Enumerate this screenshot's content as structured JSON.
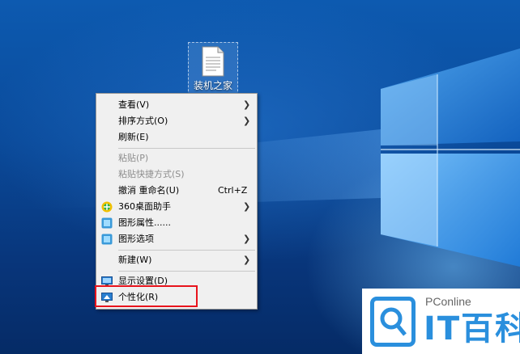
{
  "desktop": {
    "file_icon": {
      "label": "装机之家",
      "icon": "document-icon"
    }
  },
  "context_menu": {
    "items": [
      {
        "label": "查看(V)",
        "submenu": true,
        "enabled": true
      },
      {
        "label": "排序方式(O)",
        "submenu": true,
        "enabled": true
      },
      {
        "label": "刷新(E)",
        "enabled": true
      },
      {
        "label": "粘贴(P)",
        "enabled": false
      },
      {
        "label": "粘贴快捷方式(S)",
        "enabled": false
      },
      {
        "label": "撤消 重命名(U)",
        "shortcut": "Ctrl+Z",
        "enabled": true
      },
      {
        "label": "360桌面助手",
        "submenu": true,
        "enabled": true,
        "icon": "360-icon"
      },
      {
        "label": "图形属性......",
        "enabled": true,
        "icon": "graphics-properties-icon"
      },
      {
        "label": "图形选项",
        "submenu": true,
        "enabled": true,
        "icon": "graphics-options-icon"
      },
      {
        "label": "新建(W)",
        "submenu": true,
        "enabled": true
      },
      {
        "label": "显示设置(D)",
        "enabled": true,
        "icon": "display-settings-icon"
      },
      {
        "label": "个性化(R)",
        "enabled": true,
        "icon": "personalize-icon",
        "highlighted": true
      }
    ]
  },
  "watermark": {
    "brand_small": "PConline",
    "brand_big": "IT百科",
    "accent_color": "#2a8fdd"
  },
  "highlight_color": "#e8131c"
}
